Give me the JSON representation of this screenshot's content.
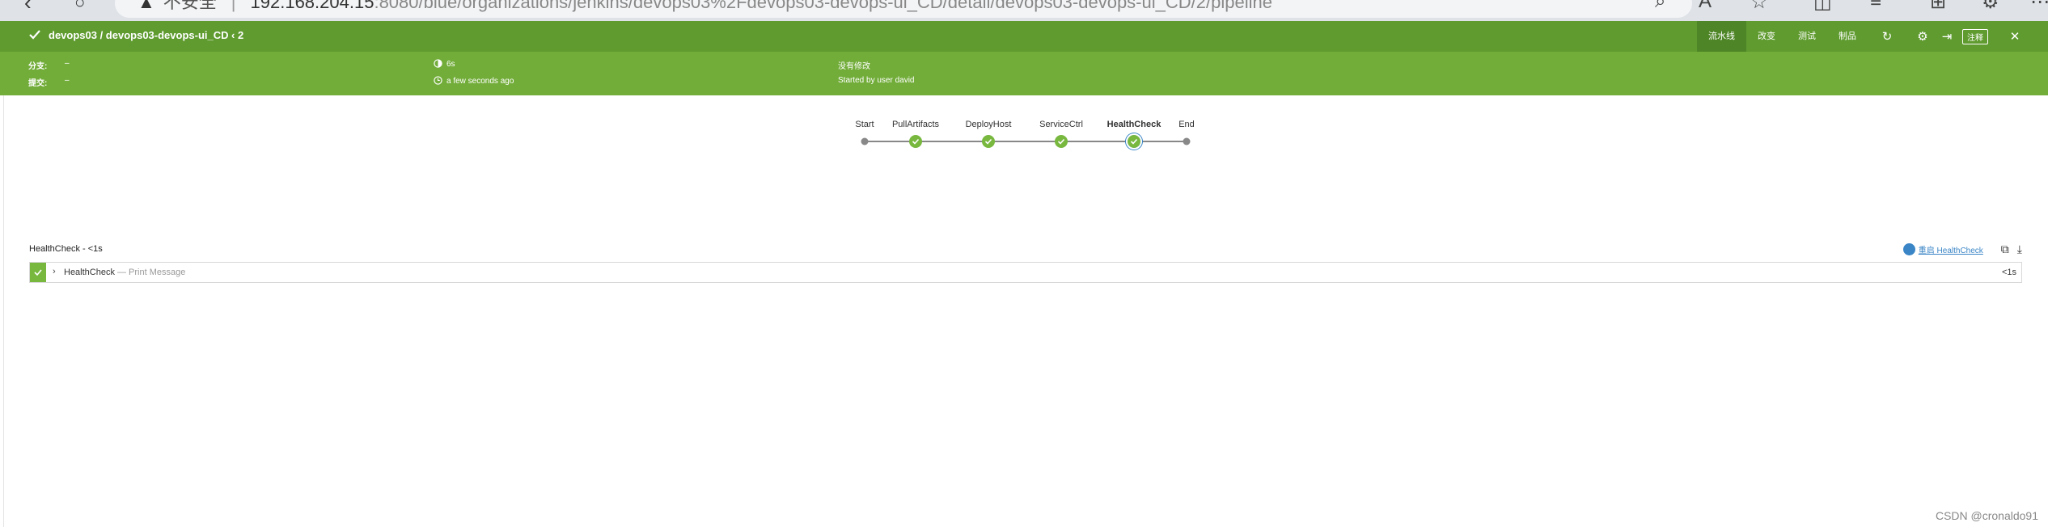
{
  "browser": {
    "back": "‹",
    "reload": "○",
    "security": "不安全",
    "host": "192.168.204.15",
    "path": ":8080/blue/organizations/jenkins/devops03%2Fdevops03-devops-ui_CD/detail/devops03-devops-ui_CD/2/pipeline"
  },
  "header": {
    "title": "devops03 / devops03-devops-ui_CD",
    "run": "‹ 2",
    "tabs": [
      "流水线",
      "改变",
      "测试",
      "制品"
    ],
    "active_tab": "流水线",
    "note_button": "注释"
  },
  "info": {
    "branch_label": "分支:",
    "branch_value": "–",
    "commit_label": "提交:",
    "commit_value": "–",
    "duration": "6s",
    "time_ago": "a few seconds ago",
    "changes": "没有修改",
    "started_by": "Started by user david"
  },
  "pipeline": {
    "stages": [
      {
        "name": "Start",
        "status": "start"
      },
      {
        "name": "PullArtifacts",
        "status": "success"
      },
      {
        "name": "DeployHost",
        "status": "success"
      },
      {
        "name": "ServiceCtrl",
        "status": "success"
      },
      {
        "name": "HealthCheck",
        "status": "success",
        "selected": true
      },
      {
        "name": "End",
        "status": "end"
      }
    ]
  },
  "steps": {
    "header": "HealthCheck - <1s",
    "restart_label": "重启 HealthCheck",
    "rows": [
      {
        "name": "HealthCheck",
        "desc": "— Print Message",
        "time": "<1s"
      }
    ]
  },
  "colors": {
    "header_bg": "#5f9b2f",
    "info_bg": "#72ad3a",
    "success": "#78b83f",
    "link": "#3a85c6"
  },
  "watermark": "CSDN @cronaldo91"
}
